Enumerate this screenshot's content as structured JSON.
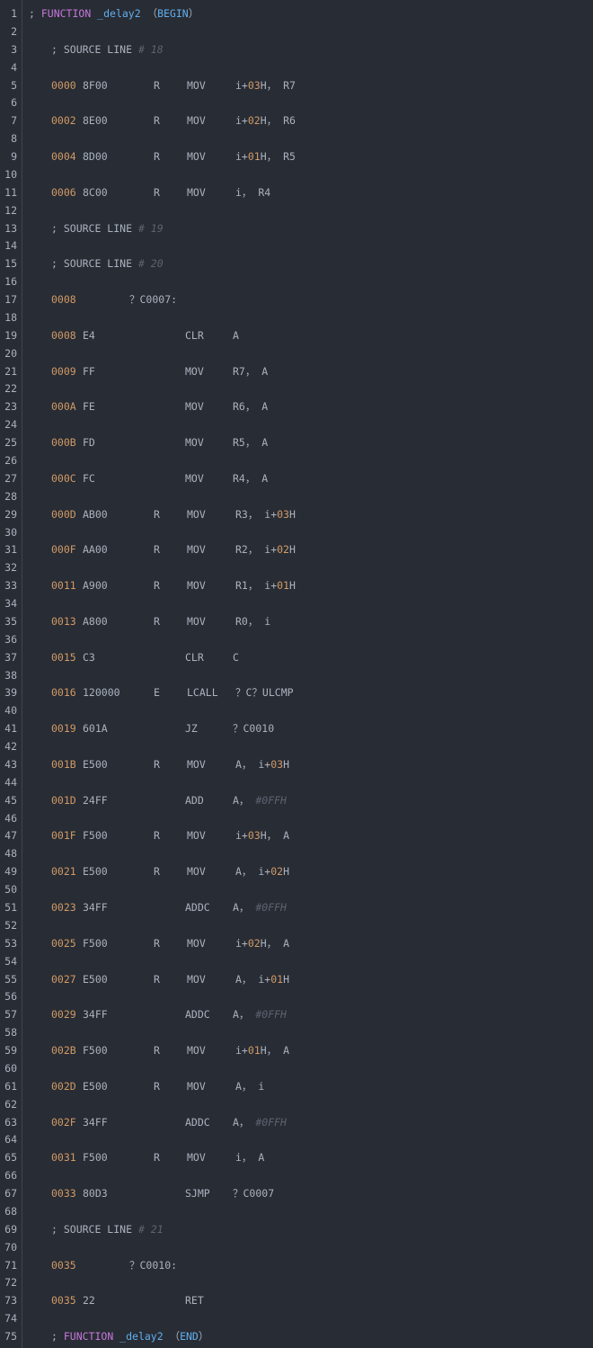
{
  "editor": {
    "colors": {
      "background": "#282c34",
      "text": "#abb2bf",
      "number": "#d19a66",
      "keyword": "#c678dd",
      "function": "#61afef",
      "comment": "#5c6370"
    },
    "lines": [
      {
        "n": 1,
        "p": [
          [
            "text",
            "; "
          ],
          [
            "kw",
            "FUNCTION "
          ],
          [
            "fn",
            "_delay2"
          ],
          [
            "text",
            " （"
          ],
          [
            "fn",
            "BEGIN"
          ],
          [
            "text",
            "）"
          ]
        ]
      },
      {
        "n": 2,
        "p": []
      },
      {
        "n": 3,
        "p": [
          [
            "text",
            "; SOURCE LINE "
          ],
          [
            "cm",
            "# 18"
          ]
        ]
      },
      {
        "n": 4,
        "p": []
      },
      {
        "n": 5,
        "a": "0000",
        "h": "8F00",
        "r": "R",
        "m": "MOV",
        "o": [
          [
            "text",
            "i+"
          ],
          [
            "num",
            "03"
          ],
          [
            "text",
            "H， R7"
          ]
        ]
      },
      {
        "n": 6,
        "p": []
      },
      {
        "n": 7,
        "a": "0002",
        "h": "8E00",
        "r": "R",
        "m": "MOV",
        "o": [
          [
            "text",
            "i+"
          ],
          [
            "num",
            "02"
          ],
          [
            "text",
            "H， R6"
          ]
        ]
      },
      {
        "n": 8,
        "p": []
      },
      {
        "n": 9,
        "a": "0004",
        "h": "8D00",
        "r": "R",
        "m": "MOV",
        "o": [
          [
            "text",
            "i+"
          ],
          [
            "num",
            "01"
          ],
          [
            "text",
            "H， R5"
          ]
        ]
      },
      {
        "n": 10,
        "p": []
      },
      {
        "n": 11,
        "a": "0006",
        "h": "8C00",
        "r": "R",
        "m": "MOV",
        "o": [
          [
            "text",
            "i， R4"
          ]
        ]
      },
      {
        "n": 12,
        "p": []
      },
      {
        "n": 13,
        "p": [
          [
            "text",
            "; SOURCE LINE "
          ],
          [
            "cm",
            "# 19"
          ]
        ]
      },
      {
        "n": 14,
        "p": []
      },
      {
        "n": 15,
        "p": [
          [
            "text",
            "; SOURCE LINE "
          ],
          [
            "cm",
            "# 20"
          ]
        ]
      },
      {
        "n": 16,
        "p": []
      },
      {
        "n": 17,
        "a": "0008",
        "lbl": "？C0007:"
      },
      {
        "n": 18,
        "p": []
      },
      {
        "n": 19,
        "a": "0008",
        "h": "E4",
        "m": "CLR",
        "o": [
          [
            "text",
            "A"
          ]
        ]
      },
      {
        "n": 20,
        "p": []
      },
      {
        "n": 21,
        "a": "0009",
        "h": "FF",
        "m": "MOV",
        "o": [
          [
            "text",
            "R7， A"
          ]
        ]
      },
      {
        "n": 22,
        "p": []
      },
      {
        "n": 23,
        "a": "000A",
        "h": "FE",
        "m": "MOV",
        "o": [
          [
            "text",
            "R6， A"
          ]
        ]
      },
      {
        "n": 24,
        "p": []
      },
      {
        "n": 25,
        "a": "000B",
        "h": "FD",
        "m": "MOV",
        "o": [
          [
            "text",
            "R5， A"
          ]
        ]
      },
      {
        "n": 26,
        "p": []
      },
      {
        "n": 27,
        "a": "000C",
        "h": "FC",
        "m": "MOV",
        "o": [
          [
            "text",
            "R4， A"
          ]
        ]
      },
      {
        "n": 28,
        "p": []
      },
      {
        "n": 29,
        "a": "000D",
        "h": "AB00",
        "r": "R",
        "m": "MOV",
        "o": [
          [
            "text",
            "R3， i+"
          ],
          [
            "num",
            "03"
          ],
          [
            "text",
            "H"
          ]
        ]
      },
      {
        "n": 30,
        "p": []
      },
      {
        "n": 31,
        "a": "000F",
        "h": "AA00",
        "r": "R",
        "m": "MOV",
        "o": [
          [
            "text",
            "R2， i+"
          ],
          [
            "num",
            "02"
          ],
          [
            "text",
            "H"
          ]
        ]
      },
      {
        "n": 32,
        "p": []
      },
      {
        "n": 33,
        "a": "0011",
        "h": "A900",
        "r": "R",
        "m": "MOV",
        "o": [
          [
            "text",
            "R1， i+"
          ],
          [
            "num",
            "01"
          ],
          [
            "text",
            "H"
          ]
        ]
      },
      {
        "n": 34,
        "p": []
      },
      {
        "n": 35,
        "a": "0013",
        "h": "A800",
        "r": "R",
        "m": "MOV",
        "o": [
          [
            "text",
            "R0， i"
          ]
        ]
      },
      {
        "n": 36,
        "p": []
      },
      {
        "n": 37,
        "a": "0015",
        "h": "C3",
        "m": "CLR",
        "o": [
          [
            "text",
            "C"
          ]
        ]
      },
      {
        "n": 38,
        "p": []
      },
      {
        "n": 39,
        "a": "0016",
        "h": "120000",
        "r": "E",
        "m": "LCALL",
        "o": [
          [
            "text",
            "？C？ULCMP"
          ]
        ]
      },
      {
        "n": 40,
        "p": []
      },
      {
        "n": 41,
        "a": "0019",
        "h": "601A",
        "m": "JZ",
        "o": [
          [
            "text",
            "？C0010"
          ]
        ]
      },
      {
        "n": 42,
        "p": []
      },
      {
        "n": 43,
        "a": "001B",
        "h": "E500",
        "r": "R",
        "m": "MOV",
        "o": [
          [
            "text",
            "A， i+"
          ],
          [
            "num",
            "03"
          ],
          [
            "text",
            "H"
          ]
        ]
      },
      {
        "n": 44,
        "p": []
      },
      {
        "n": 45,
        "a": "001D",
        "h": "24FF",
        "m": "ADD",
        "o": [
          [
            "text",
            "A， "
          ],
          [
            "cm",
            "#0FFH"
          ]
        ]
      },
      {
        "n": 46,
        "p": []
      },
      {
        "n": 47,
        "a": "001F",
        "h": "F500",
        "r": "R",
        "m": "MOV",
        "o": [
          [
            "text",
            "i+"
          ],
          [
            "num",
            "03"
          ],
          [
            "text",
            "H， A"
          ]
        ]
      },
      {
        "n": 48,
        "p": []
      },
      {
        "n": 49,
        "a": "0021",
        "h": "E500",
        "r": "R",
        "m": "MOV",
        "o": [
          [
            "text",
            "A， i+"
          ],
          [
            "num",
            "02"
          ],
          [
            "text",
            "H"
          ]
        ]
      },
      {
        "n": 50,
        "p": []
      },
      {
        "n": 51,
        "a": "0023",
        "h": "34FF",
        "m": "ADDC",
        "o": [
          [
            "text",
            "A， "
          ],
          [
            "cm",
            "#0FFH"
          ]
        ]
      },
      {
        "n": 52,
        "p": []
      },
      {
        "n": 53,
        "a": "0025",
        "h": "F500",
        "r": "R",
        "m": "MOV",
        "o": [
          [
            "text",
            "i+"
          ],
          [
            "num",
            "02"
          ],
          [
            "text",
            "H， A"
          ]
        ]
      },
      {
        "n": 54,
        "p": []
      },
      {
        "n": 55,
        "a": "0027",
        "h": "E500",
        "r": "R",
        "m": "MOV",
        "o": [
          [
            "text",
            "A， i+"
          ],
          [
            "num",
            "01"
          ],
          [
            "text",
            "H"
          ]
        ]
      },
      {
        "n": 56,
        "p": []
      },
      {
        "n": 57,
        "a": "0029",
        "h": "34FF",
        "m": "ADDC",
        "o": [
          [
            "text",
            "A， "
          ],
          [
            "cm",
            "#0FFH"
          ]
        ]
      },
      {
        "n": 58,
        "p": []
      },
      {
        "n": 59,
        "a": "002B",
        "h": "F500",
        "r": "R",
        "m": "MOV",
        "o": [
          [
            "text",
            "i+"
          ],
          [
            "num",
            "01"
          ],
          [
            "text",
            "H， A"
          ]
        ]
      },
      {
        "n": 60,
        "p": []
      },
      {
        "n": 61,
        "a": "002D",
        "h": "E500",
        "r": "R",
        "m": "MOV",
        "o": [
          [
            "text",
            "A， i"
          ]
        ]
      },
      {
        "n": 62,
        "p": []
      },
      {
        "n": 63,
        "a": "002F",
        "h": "34FF",
        "m": "ADDC",
        "o": [
          [
            "text",
            "A， "
          ],
          [
            "cm",
            "#0FFH"
          ]
        ]
      },
      {
        "n": 64,
        "p": []
      },
      {
        "n": 65,
        "a": "0031",
        "h": "F500",
        "r": "R",
        "m": "MOV",
        "o": [
          [
            "text",
            "i， A"
          ]
        ]
      },
      {
        "n": 66,
        "p": []
      },
      {
        "n": 67,
        "a": "0033",
        "h": "80D3",
        "m": "SJMP",
        "o": [
          [
            "text",
            "？C0007"
          ]
        ]
      },
      {
        "n": 68,
        "p": []
      },
      {
        "n": 69,
        "p": [
          [
            "text",
            "; SOURCE LINE "
          ],
          [
            "cm",
            "# 21"
          ]
        ]
      },
      {
        "n": 70,
        "p": []
      },
      {
        "n": 71,
        "a": "0035",
        "lbl": "？C0010:"
      },
      {
        "n": 72,
        "p": []
      },
      {
        "n": 73,
        "a": "0035",
        "h": "22",
        "m": "RET",
        "o": []
      },
      {
        "n": 74,
        "p": []
      },
      {
        "n": 75,
        "p": [
          [
            "text",
            "; "
          ],
          [
            "kw",
            "FUNCTION "
          ],
          [
            "fn",
            "_delay2"
          ],
          [
            "text",
            " （"
          ],
          [
            "fn",
            "END"
          ],
          [
            "text",
            "）"
          ]
        ]
      }
    ]
  }
}
